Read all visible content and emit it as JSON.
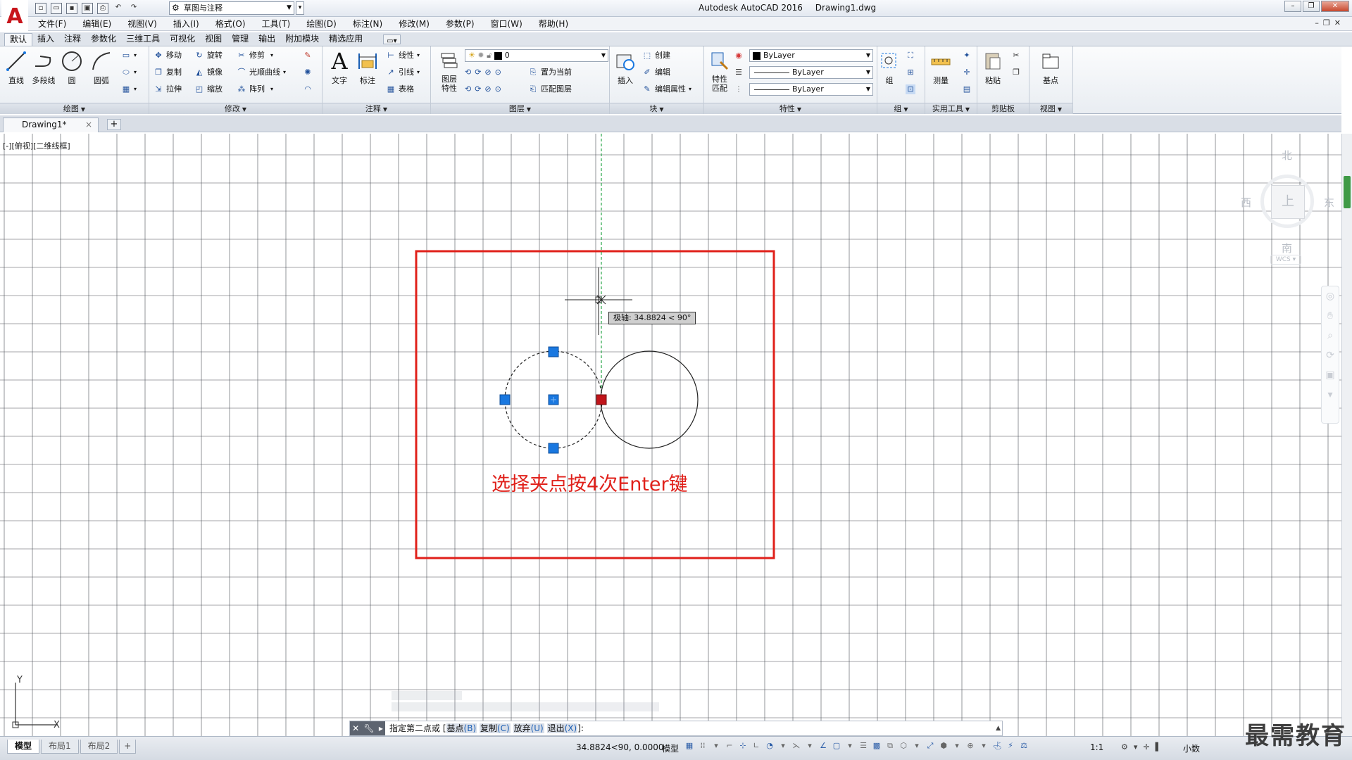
{
  "window": {
    "app_name": "Autodesk AutoCAD 2016",
    "file_name": "Drawing1.dwg",
    "workspace": "草图与注释",
    "logo_glyph": "A"
  },
  "menu": [
    "文件(F)",
    "编辑(E)",
    "视图(V)",
    "插入(I)",
    "格式(O)",
    "工具(T)",
    "绘图(D)",
    "标注(N)",
    "修改(M)",
    "参数(P)",
    "窗口(W)",
    "帮助(H)"
  ],
  "ribbon_tabs": [
    "默认",
    "插入",
    "注释",
    "参数化",
    "三维工具",
    "可视化",
    "视图",
    "管理",
    "输出",
    "附加模块",
    "精选应用"
  ],
  "active_ribbon_tab": "默认",
  "ribbon": {
    "draw": {
      "title": "绘图",
      "line": "直线",
      "polyline": "多段线",
      "circle": "圆",
      "arc": "圆弧"
    },
    "modify": {
      "title": "修改",
      "move": "移动",
      "rotate": "旋转",
      "trim": "修剪",
      "copy": "复制",
      "mirror": "镜像",
      "fillet": "光顺曲线",
      "stretch": "拉伸",
      "scale": "缩放",
      "array": "阵列"
    },
    "annotation": {
      "title": "注释",
      "text": "文字",
      "dimension": "标注",
      "linear": "线性",
      "leader": "引线",
      "table": "表格"
    },
    "layers": {
      "title": "图层",
      "properties": "图层特性",
      "current_layer": "0",
      "make_current": "置为当前",
      "match_layer": "匹配图层"
    },
    "block": {
      "title": "块",
      "insert": "插入",
      "create": "创建",
      "edit": "编辑",
      "edit_attributes": "编辑属性"
    },
    "properties": {
      "title": "特性",
      "match": "特性匹配",
      "color": "ByLayer",
      "linetype": "ByLayer",
      "lineweight": "ByLayer"
    },
    "groups": {
      "title": "组",
      "group": "组"
    },
    "utilities": {
      "title": "实用工具",
      "measure": "测量"
    },
    "clipboard": {
      "title": "剪贴板",
      "paste": "粘贴"
    },
    "view": {
      "title": "视图",
      "base": "基点"
    }
  },
  "file_tab": {
    "label": "Drawing1*",
    "close": "×",
    "new": "+"
  },
  "viewport_label": "[-][俯视][二维线框]",
  "polar_tooltip": "极轴: 34.8824 < 90°",
  "annotation_text": "选择夹点按4次Enter键",
  "viewcube": {
    "north": "北",
    "south": "南",
    "east": "东",
    "west": "西",
    "face": "上",
    "wcs": "WCS"
  },
  "ucs": {
    "x": "X",
    "y": "Y"
  },
  "command": {
    "prompt": "指定第二点或",
    "options": [
      {
        "label": "基点",
        "key": "(B)"
      },
      {
        "label": "复制",
        "key": "(C)"
      },
      {
        "label": "放弃",
        "key": "(U)"
      },
      {
        "label": "退出",
        "key": "(X)"
      }
    ],
    "suffix": "]:",
    "open_bracket": "["
  },
  "status": {
    "layouts": [
      "模型",
      "布局1",
      "布局2"
    ],
    "add_layout": "+",
    "coords": "34.8824<90, 0.0000",
    "mode": "模型",
    "scale": "1:1",
    "units": "小数"
  },
  "watermark": "最需教育",
  "colors": {
    "accent_red": "#e0201a",
    "grip_blue": "#1a78e0",
    "grip_hot": "#c0141a",
    "tracking_green": "#2aa64a"
  }
}
